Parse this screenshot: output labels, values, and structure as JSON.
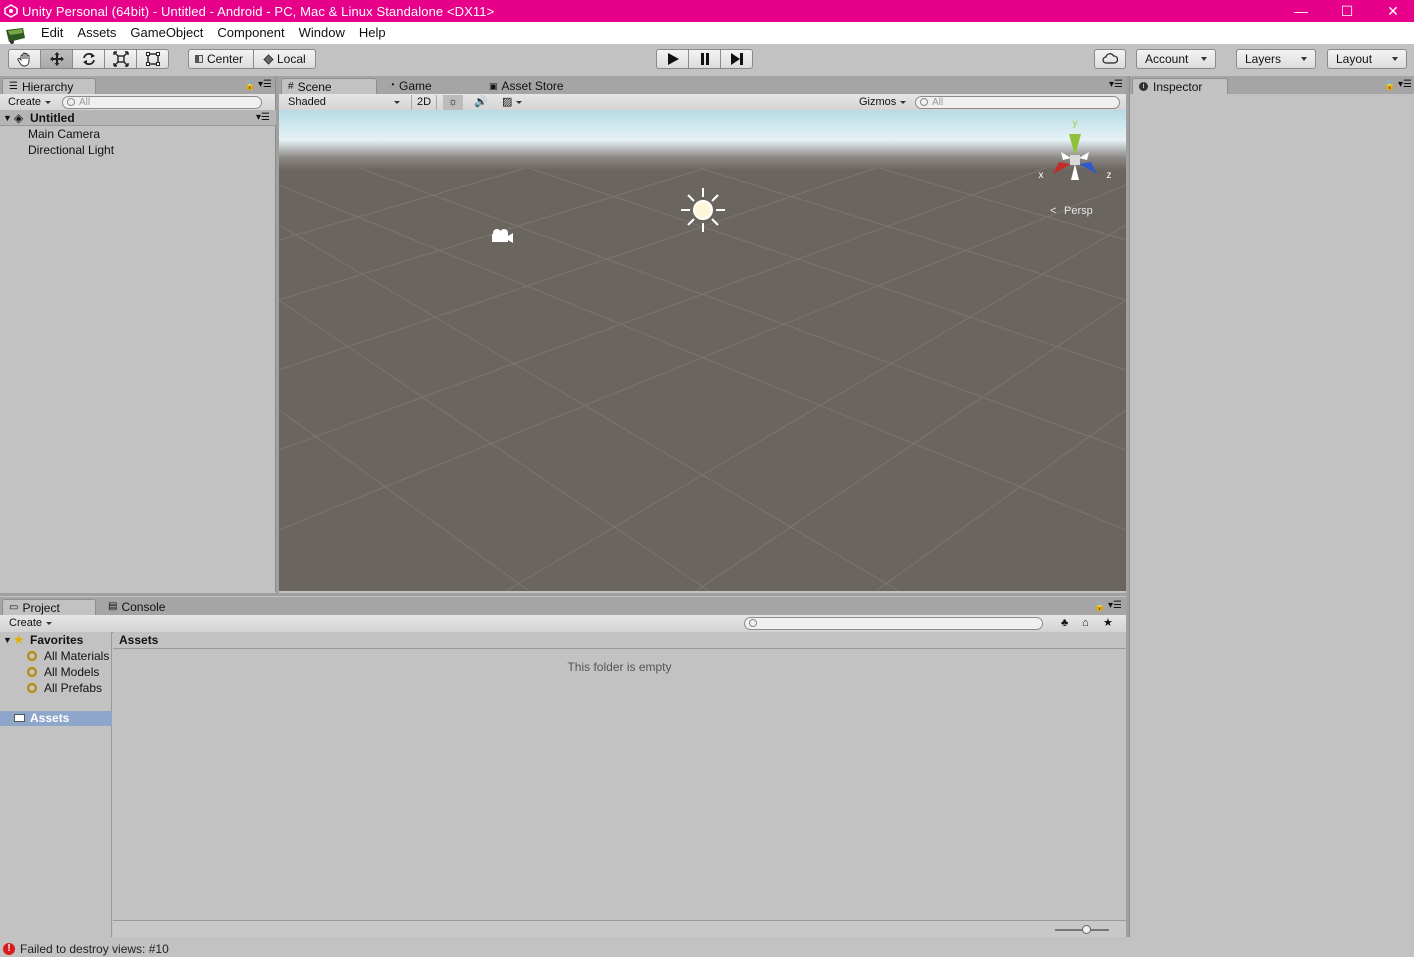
{
  "window": {
    "title": "Unity Personal (64bit) - Untitled - Android - PC, Mac & Linux Standalone <DX11>",
    "controls": {
      "minimize": "—",
      "maximize": "☐",
      "close": "✕"
    }
  },
  "menu": [
    "Edit",
    "Assets",
    "GameObject",
    "Component",
    "Window",
    "Help"
  ],
  "toolbar": {
    "pivot_mode": "Center",
    "pivot_rotation": "Local",
    "account": "Account",
    "layers": "Layers",
    "layout": "Layout"
  },
  "hierarchy": {
    "tab": "Hierarchy",
    "create": "Create",
    "search_placeholder": "All",
    "scene_name": "Untitled",
    "items": [
      "Main Camera",
      "Directional Light"
    ]
  },
  "scene": {
    "tabs": [
      "Scene",
      "Game",
      "Asset Store"
    ],
    "shading": "Shaded",
    "mode_2d": "2D",
    "gizmos": "Gizmos",
    "search_placeholder": "All",
    "axis_x": "x",
    "axis_y": "y",
    "axis_z": "z",
    "projection": "Persp"
  },
  "inspector": {
    "tab": "Inspector"
  },
  "project": {
    "tabs": [
      "Project",
      "Console"
    ],
    "create": "Create",
    "favorites_label": "Favorites",
    "favorites": [
      "All Materials",
      "All Models",
      "All Prefabs"
    ],
    "assets_root": "Assets",
    "breadcrumb": "Assets",
    "empty_message": "This folder is empty"
  },
  "status": {
    "message": "Failed to destroy views: #10"
  },
  "colors": {
    "titlebar": "#e6008a",
    "scene_ground": "#6b6560",
    "sky": "#cfe9f0"
  }
}
